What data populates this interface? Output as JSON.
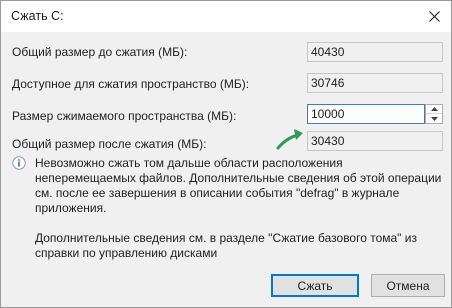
{
  "window": {
    "title": "Сжать C:",
    "close_icon": "close-icon"
  },
  "rows": [
    {
      "label": "Общий размер до сжатия (МБ):",
      "value": "40430"
    },
    {
      "label": "Доступное для сжатия пространство (МБ):",
      "value": "30746"
    },
    {
      "label": "Размер сжимаемого пространства (МБ):",
      "value": "10000"
    },
    {
      "label": "Общий размер после сжатия (МБ):",
      "value": "30430"
    }
  ],
  "info": {
    "icon": "info-icon",
    "text": "Невозможно сжать том дальше области расположения неперемещаемых файлов. Дополнительные сведения об этой операции см. после ее завершения в описании события \"defrag\" в журнале приложения."
  },
  "more_info": {
    "text": "Дополнительные сведения см. в разделе \"Сжатие базового тома\" из справки по управлению дисками"
  },
  "buttons": {
    "shrink_label": "Сжать",
    "cancel_label": "Отмена"
  },
  "colors": {
    "arrow": "#2e9b57",
    "focus_border": "#3c7fb1",
    "default_button_border": "#0078d7"
  }
}
